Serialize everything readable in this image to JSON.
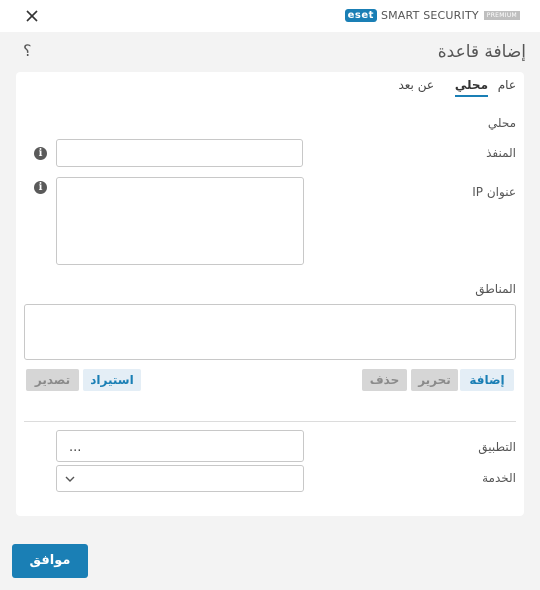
{
  "titlebar": {
    "brand_logo": "eset",
    "brand_name": "SMART SECURITY",
    "brand_edition": "PREMIUM",
    "close_icon": "close-icon"
  },
  "header": {
    "title": "إضافة قاعدة",
    "help_glyph": "؟"
  },
  "tabs": [
    {
      "label": "عام",
      "active": false
    },
    {
      "label": "محلي",
      "active": true
    },
    {
      "label": "عن بعد",
      "active": false
    }
  ],
  "form": {
    "section_local": "محلي",
    "port_label": "المنفذ",
    "port_value": "",
    "ip_label": "عنوان IP",
    "ip_value": "",
    "zones_label": "المناطق",
    "info_glyph": "i",
    "buttons": {
      "add": "إضافة",
      "edit": "تحرير",
      "delete": "حذف",
      "import": "استيراد",
      "export": "تصدير"
    },
    "application_label": "التطبيق",
    "application_value": "...",
    "service_label": "الخدمة",
    "service_value": ""
  },
  "footer": {
    "ok_label": "موافق"
  },
  "colors": {
    "accent": "#1a7fb5",
    "background": "#f3f3f3",
    "panel": "#ffffff"
  }
}
